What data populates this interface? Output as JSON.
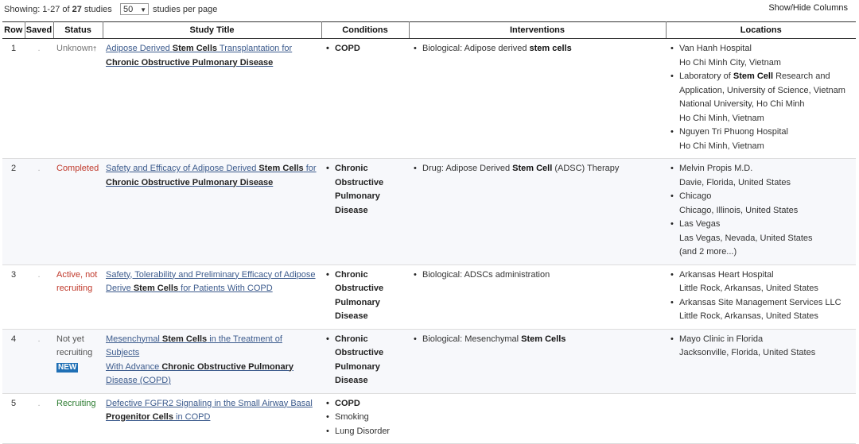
{
  "toolbar": {
    "showing_prefix": "Showing: 1-27 of ",
    "total": "27",
    "showing_suffix": " studies",
    "per_page_value": "50",
    "per_page_label": "studies per page",
    "show_hide": "Show/Hide Columns"
  },
  "columns": {
    "row": "Row",
    "saved": "Saved",
    "status": "Status",
    "title": "Study Title",
    "conditions": "Conditions",
    "interventions": "Interventions",
    "locations": "Locations"
  },
  "rows": [
    {
      "num": "1",
      "saved": ".",
      "status": "Unknown",
      "status_sup": "†",
      "title_parts": [
        "Adipose Derived ",
        "Stem Cells",
        " Transplantation for ",
        "Chronic Obstructive Pulmonary Disease"
      ],
      "conditions": [
        "COPD"
      ],
      "interventions": [
        [
          "Biological: Adipose derived ",
          "stem cells",
          ""
        ]
      ],
      "locations": [
        [
          "Van Hanh Hospital",
          "Ho Chi Minh City, Vietnam"
        ],
        [
          "Laboratory of ",
          "Stem Cell",
          " Research and",
          "Application, University of Science, Vietnam",
          "National University, Ho Chi Minh",
          "Ho Chi Minh, Vietnam"
        ],
        [
          "Nguyen Tri Phuong Hospital",
          "Ho Chi Minh, Vietnam"
        ]
      ]
    },
    {
      "num": "2",
      "saved": ".",
      "status": "Completed",
      "title_parts": [
        "Safety and Efficacy of Adipose Derived ",
        "Stem Cells",
        " for",
        "Chronic Obstructive Pulmonary Disease"
      ],
      "conditions": [
        "Chronic",
        "Obstructive",
        "Pulmonary",
        "Disease"
      ],
      "interventions": [
        [
          "Drug: Adipose Derived ",
          "Stem Cell",
          " (ADSC) Therapy"
        ]
      ],
      "locations": [
        [
          "Melvin Propis M.D.",
          "Davie, Florida, United States"
        ],
        [
          "Chicago",
          "Chicago, Illinois, United States"
        ],
        [
          "Las Vegas",
          "Las Vegas, Nevada, United States",
          "(and 2 more...)"
        ]
      ]
    },
    {
      "num": "3",
      "saved": ".",
      "status_line1": "Active, not",
      "status_line2": "recruiting",
      "title_parts": [
        "Safety, Tolerability and Preliminary Efficacy of Adipose",
        "Derive ",
        "Stem Cells",
        " for Patients With COPD"
      ],
      "conditions": [
        "Chronic",
        "Obstructive",
        "Pulmonary",
        "Disease"
      ],
      "interventions": [
        [
          "Biological: ADSCs administration",
          "",
          ""
        ]
      ],
      "locations": [
        [
          "Arkansas Heart Hospital",
          "Little Rock, Arkansas, United States"
        ],
        [
          "Arkansas Site Management Services LLC",
          "Little Rock, Arkansas, United States"
        ]
      ]
    },
    {
      "num": "4",
      "saved": ".",
      "status_line1": "Not yet",
      "status_line2": "recruiting",
      "badge": "NEW",
      "title_parts": [
        "Mesenchymal ",
        "Stem Cells",
        " in the Treatment of Subjects",
        "With Advance ",
        "Chronic Obstructive Pulmonary",
        "Disease",
        " (COPD)"
      ],
      "conditions": [
        "Chronic",
        "Obstructive",
        "Pulmonary",
        "Disease"
      ],
      "interventions": [
        [
          "Biological: Mesenchymal ",
          "Stem Cells",
          ""
        ]
      ],
      "locations": [
        [
          "Mayo Clinic in Florida",
          "Jacksonville, Florida, United States"
        ]
      ]
    },
    {
      "num": "5",
      "saved": ".",
      "status": "Recruiting",
      "title_parts": [
        "Defective FGFR2 Signaling in the Small Airway Basal",
        "Progenitor ",
        "Cells",
        " in COPD"
      ],
      "conditions": [
        "COPD",
        "Smoking",
        "Lung Disorder"
      ]
    }
  ]
}
